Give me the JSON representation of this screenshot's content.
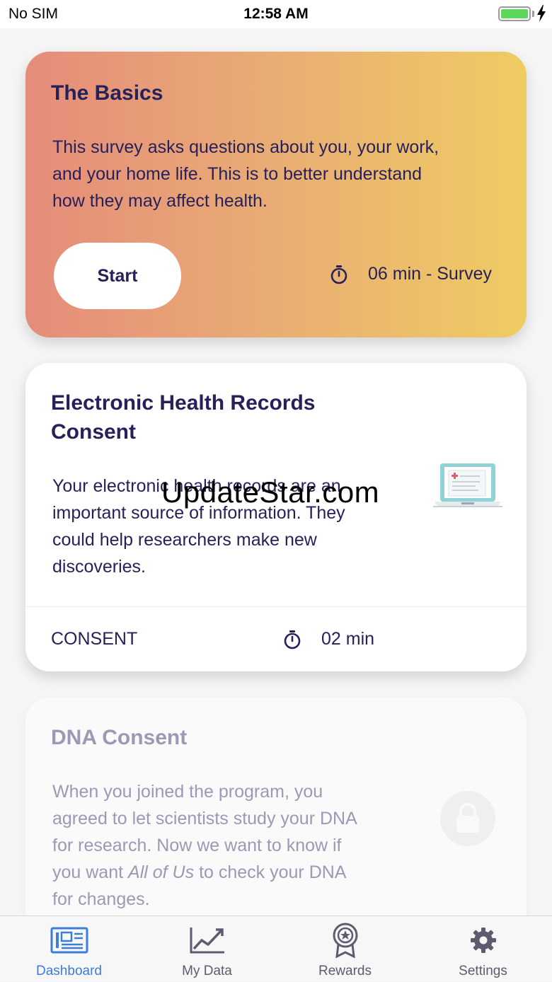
{
  "status_bar": {
    "carrier": "No SIM",
    "time": "12:58 AM",
    "battery_icon": "battery-full-icon",
    "charging_icon": "charging-bolt-icon"
  },
  "cards": [
    {
      "title": "The Basics",
      "body_lines": [
        "This survey asks questions about you, your work,",
        "and your home life. This is to better understand",
        "how they may affect health."
      ],
      "button_label": "Start",
      "duration": "06 min - Survey",
      "icon": "stopwatch-icon",
      "gradient": [
        "#e58c7a",
        "#efcc62"
      ]
    },
    {
      "title_lines": [
        "Electronic Health Records",
        "Consent"
      ],
      "body_lines": [
        "Your electronic health records are an",
        "important source of information. They",
        "could help researchers make new",
        "discoveries."
      ],
      "action_label": "CONSENT",
      "duration": "02 min",
      "illustration": "laptop-health-record-icon"
    },
    {
      "title": "DNA Consent",
      "body_lines": [
        "When you joined the program, you",
        "agreed to let scientists study your DNA",
        "for research. Now we want to know if",
        "you want",
        "All of Us",
        "to check your DNA",
        "for changes."
      ],
      "locked_icon": "lock-icon"
    }
  ],
  "watermark": "UpdateStar.com",
  "tab_bar": {
    "active_color": "#3b7dd8",
    "tabs": [
      {
        "label": "Dashboard",
        "icon": "newspaper-icon",
        "active": true
      },
      {
        "label": "My Data",
        "icon": "line-chart-icon",
        "active": false
      },
      {
        "label": "Rewards",
        "icon": "award-badge-icon",
        "active": false
      },
      {
        "label": "Settings",
        "icon": "gear-icon",
        "active": false
      }
    ]
  }
}
